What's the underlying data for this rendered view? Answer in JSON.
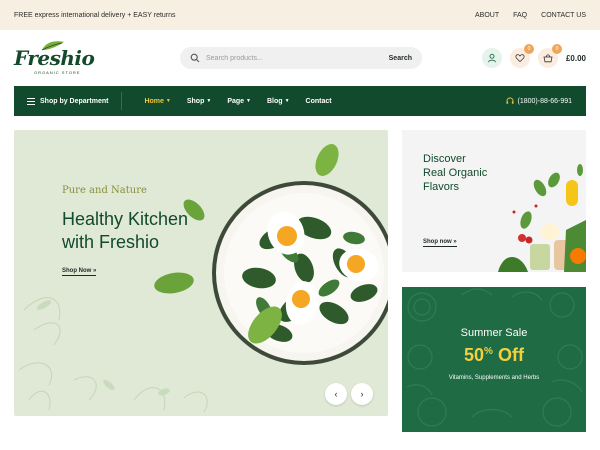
{
  "topbar": {
    "promo": "FREE express international delivery + EASY returns",
    "links": [
      "ABOUT",
      "FAQ",
      "CONTACT US"
    ]
  },
  "brand": {
    "name": "Freshio",
    "tagline": "ORGANIC STORE",
    "primary_color": "#114a2d",
    "accent_color": "#f4c542"
  },
  "search": {
    "placeholder": "Search products...",
    "button_label": "Search"
  },
  "header_actions": {
    "user_icon": "user-icon",
    "wishlist_count": "0",
    "cart_count": "0",
    "cart_total": "£0.00"
  },
  "nav": {
    "department_label": "Shop by Department",
    "items": [
      {
        "label": "Home",
        "has_dropdown": true,
        "active": true
      },
      {
        "label": "Shop",
        "has_dropdown": true,
        "active": false
      },
      {
        "label": "Page",
        "has_dropdown": true,
        "active": false
      },
      {
        "label": "Blog",
        "has_dropdown": true,
        "active": false
      },
      {
        "label": "Contact",
        "has_dropdown": false,
        "active": false
      }
    ],
    "phone": "(1800)-88-66-991"
  },
  "hero": {
    "tagline": "Pure and Nature",
    "headline_line1": "Healthy Kitchen",
    "headline_line2": "with Freshio",
    "cta": "Shop Now »",
    "prev_arrow": "‹",
    "next_arrow": "›"
  },
  "banner_discover": {
    "title_line1": "Discover",
    "title_line2": "Real Organic",
    "title_line3": "Flavors",
    "cta": "Shop now »"
  },
  "banner_sale": {
    "title": "Summer Sale",
    "offer_number": "50",
    "offer_sup": "%",
    "offer_word": "Off",
    "subtitle": "Vitamins, Supplements and Herbs"
  }
}
